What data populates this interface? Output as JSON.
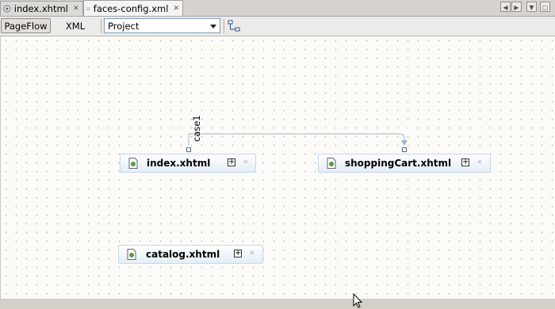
{
  "tabs": [
    {
      "label": "index.xhtml",
      "active": false,
      "icon": "xhtml-file-icon"
    },
    {
      "label": "faces-config.xml",
      "active": true,
      "icon": "jsf-config-file-icon"
    }
  ],
  "toolbar": {
    "pageflow_label": "PageFlow",
    "xml_label": "XML",
    "scope_selected": "Project"
  },
  "canvas": {
    "nodes": [
      {
        "label": "index.xhtml"
      },
      {
        "label": "shoppingCart.xhtml"
      },
      {
        "label": "catalog.xhtml"
      }
    ],
    "edges": [
      {
        "label": "case1",
        "from": "index.xhtml",
        "to": "shoppingCart.xhtml"
      }
    ]
  },
  "colors": {
    "edge": "#9fb6cf",
    "node_border": "#c7d8ea",
    "combo_border": "#7f9db9"
  }
}
